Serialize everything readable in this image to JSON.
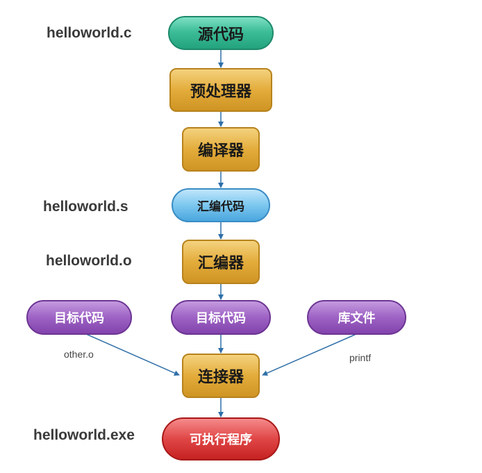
{
  "nodes": {
    "source_code": "源代码",
    "preprocessor": "预处理器",
    "compiler": "编译器",
    "assembly_code": "汇编代码",
    "assembler": "汇编器",
    "object_code_left": "目标代码",
    "object_code_center": "目标代码",
    "library_file": "库文件",
    "linker": "连接器",
    "executable": "可执行程序"
  },
  "side_labels": {
    "source_file": "helloworld.c",
    "assembly_file": "helloworld.s",
    "object_file": "helloworld.o",
    "exe_file": "helloworld.exe"
  },
  "edge_labels": {
    "other_object": "other.o",
    "printf_lib": "printf"
  },
  "colors": {
    "arrow": "#2f6fa8"
  }
}
